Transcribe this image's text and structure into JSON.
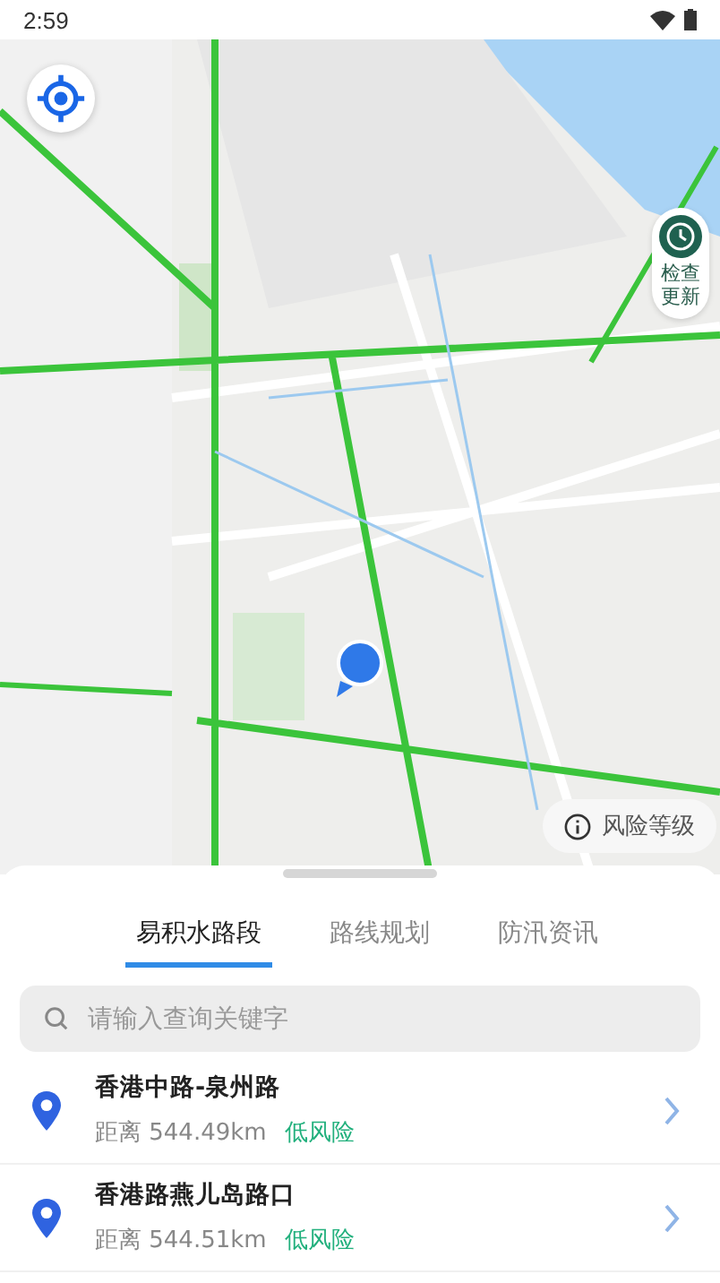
{
  "status_bar": {
    "time": "2:59"
  },
  "map": {
    "kind": "picture",
    "check_update": {
      "label": "检查更新"
    },
    "risk_level": {
      "label": "风险等级"
    }
  },
  "tabs": [
    {
      "label": "易积水路段",
      "selected": true
    },
    {
      "label": "路线规划",
      "selected": false
    },
    {
      "label": "防汛资讯",
      "selected": false
    }
  ],
  "search": {
    "placeholder": "请输入查询关键字"
  },
  "roads": [
    {
      "name": "香港中路-泉州路",
      "distance": "距离 544.49km",
      "risk": "低风险"
    },
    {
      "name": "香港路燕儿岛路口",
      "distance": "距离 544.51km",
      "risk": "低风险"
    }
  ]
}
